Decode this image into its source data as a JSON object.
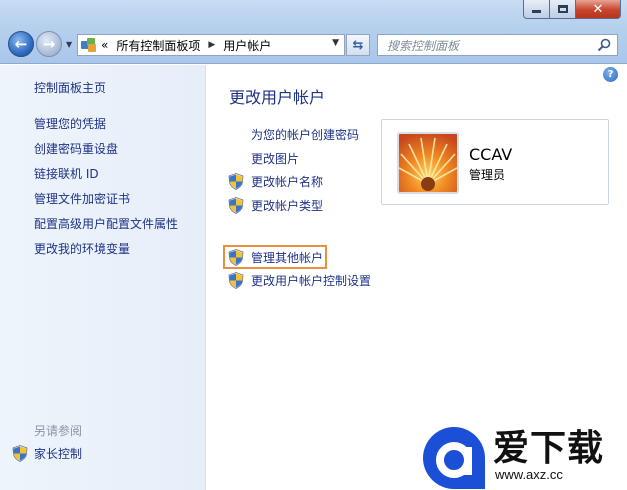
{
  "window": {
    "caption_buttons": {
      "minimize": "minimize-icon",
      "maximize": "maximize-icon",
      "close": "close-icon"
    }
  },
  "address_bar": {
    "overflow": "«",
    "crumbs": [
      "所有控制面板项",
      "用户帐户"
    ]
  },
  "search": {
    "placeholder": "搜索控制面板"
  },
  "left_pane": {
    "home": "控制面板主页",
    "links": [
      "管理您的凭据",
      "创建密码重设盘",
      "链接联机 ID",
      "管理文件加密证书",
      "配置高级用户配置文件属性",
      "更改我的环境变量"
    ],
    "see_also_title": "另请参阅",
    "see_also": [
      "家长控制"
    ]
  },
  "main": {
    "title": "更改用户帐户",
    "tasks": [
      {
        "label": "为您的帐户创建密码",
        "shield": false
      },
      {
        "label": "更改图片",
        "shield": false
      },
      {
        "label": "更改帐户名称",
        "shield": true
      },
      {
        "label": "更改帐户类型",
        "shield": true
      }
    ],
    "other_tasks": [
      {
        "label": "管理其他帐户",
        "shield": true,
        "highlighted": true
      },
      {
        "label": "更改用户帐户控制设置",
        "shield": true
      }
    ]
  },
  "user": {
    "name": "CCAV",
    "role": "管理员"
  },
  "watermark": {
    "brand": "爱下载",
    "url": "www.axz.cc"
  },
  "colors": {
    "link": "#1e3287",
    "highlight_border": "#e6913e",
    "left_pane_bg": "#eef4fb"
  }
}
